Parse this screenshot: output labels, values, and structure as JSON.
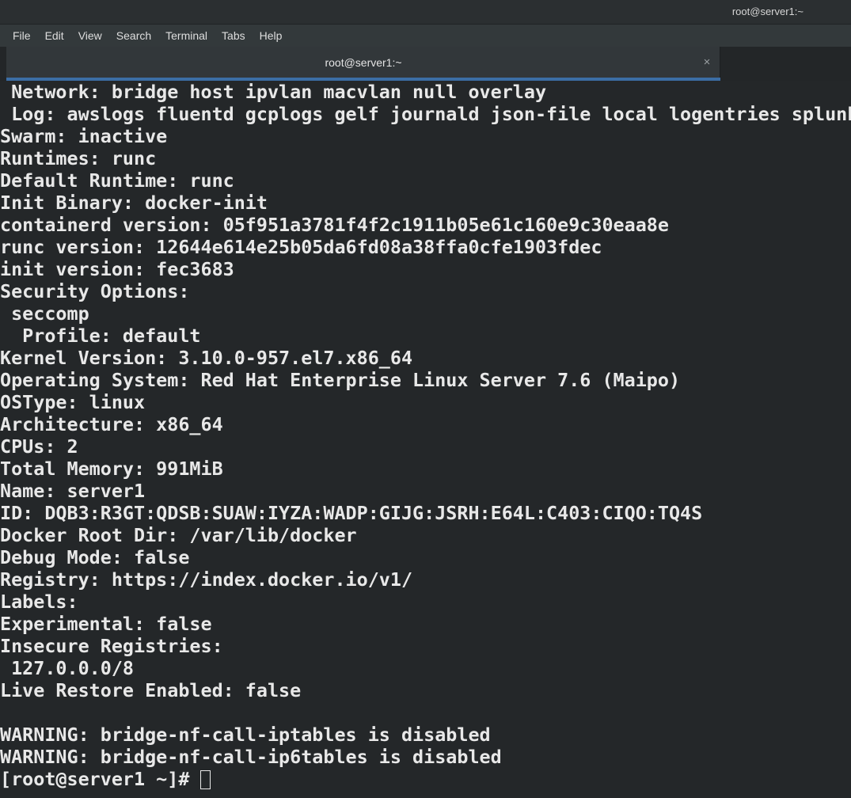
{
  "window": {
    "title": "root@server1:~"
  },
  "menubar": {
    "items": [
      {
        "label": "File"
      },
      {
        "label": "Edit"
      },
      {
        "label": "View"
      },
      {
        "label": "Search"
      },
      {
        "label": "Terminal"
      },
      {
        "label": "Tabs"
      },
      {
        "label": "Help"
      }
    ]
  },
  "tabbar": {
    "active_tab_label": "root@server1:~",
    "close_icon": "×",
    "accent_color": "#3b6ea5"
  },
  "terminal": {
    "background_color": "#242729",
    "foreground_color": "#e8e8e8",
    "lines": [
      " Network: bridge host ipvlan macvlan null overlay",
      " Log: awslogs fluentd gcplogs gelf journald json-file local logentries splunk syslog",
      "Swarm: inactive",
      "Runtimes: runc",
      "Default Runtime: runc",
      "Init Binary: docker-init",
      "containerd version: 05f951a3781f4f2c1911b05e61c160e9c30eaa8e",
      "runc version: 12644e614e25b05da6fd08a38ffa0cfe1903fdec",
      "init version: fec3683",
      "Security Options:",
      " seccomp",
      "  Profile: default",
      "Kernel Version: 3.10.0-957.el7.x86_64",
      "Operating System: Red Hat Enterprise Linux Server 7.6 (Maipo)",
      "OSType: linux",
      "Architecture: x86_64",
      "CPUs: 2",
      "Total Memory: 991MiB",
      "Name: server1",
      "ID: DQB3:R3GT:QDSB:SUAW:IYZA:WADP:GIJG:JSRH:E64L:C403:CIQO:TQ4S",
      "Docker Root Dir: /var/lib/docker",
      "Debug Mode: false",
      "Registry: https://index.docker.io/v1/",
      "Labels:",
      "Experimental: false",
      "Insecure Registries:",
      " 127.0.0.0/8",
      "Live Restore Enabled: false",
      "",
      "WARNING: bridge-nf-call-iptables is disabled",
      "WARNING: bridge-nf-call-ip6tables is disabled"
    ],
    "prompt": "[root@server1 ~]# ",
    "cursor": "block-outline-cursor"
  }
}
